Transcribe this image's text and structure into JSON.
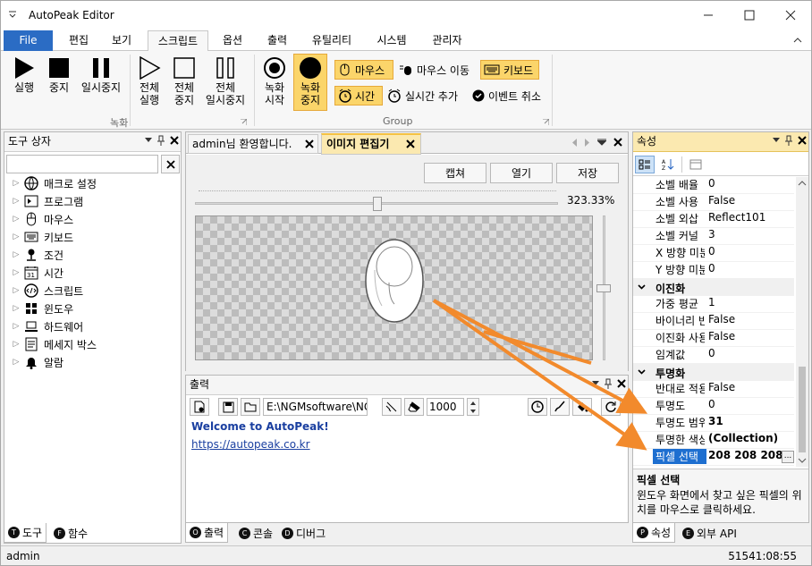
{
  "window": {
    "title": "AutoPeak Editor"
  },
  "ribbon_tabs": [
    "File",
    "편집",
    "보기",
    "스크립트",
    "옵션",
    "출력",
    "유틸리티",
    "시스템",
    "관리자"
  ],
  "ribbon": {
    "group1": [
      "실행",
      "중지",
      "일시중지"
    ],
    "group1b": [
      "전체\n실행",
      "전체\n중지",
      "전체\n일시중지"
    ],
    "group1_label": "녹화",
    "record": [
      "녹화\n시작",
      "녹화\n중지"
    ],
    "small": {
      "mouse": "마우스",
      "mouse_move": "마우스 이동",
      "keyboard": "키보드",
      "time": "시간",
      "realtime": "실시간 추가",
      "event_cancel": "이벤트 취소"
    },
    "group2_label": "Group"
  },
  "toolbox": {
    "title": "도구 상자",
    "items": [
      {
        "label": "매크로 설정",
        "icon": "globe-icon"
      },
      {
        "label": "프로그램",
        "icon": "program-icon"
      },
      {
        "label": "마우스",
        "icon": "mouse-icon"
      },
      {
        "label": "키보드",
        "icon": "keyboard-icon"
      },
      {
        "label": "조건",
        "icon": "condition-icon"
      },
      {
        "label": "시간",
        "icon": "calendar-icon",
        "num": "31"
      },
      {
        "label": "스크립트",
        "icon": "script-icon"
      },
      {
        "label": "윈도우",
        "icon": "windows-icon"
      },
      {
        "label": "하드웨어",
        "icon": "laptop-icon"
      },
      {
        "label": "메세지 박스",
        "icon": "message-icon"
      },
      {
        "label": "알람",
        "icon": "bell-icon"
      }
    ],
    "bottom_tabs": [
      {
        "letter": "T",
        "label": "도구"
      },
      {
        "letter": "F",
        "label": "함수"
      }
    ]
  },
  "doc_tabs": [
    "admin님 환영합니다.",
    "이미지 편집기"
  ],
  "editor": {
    "capture": "캡쳐",
    "open": "열기",
    "save": "저장",
    "zoom": "323.33%",
    "slider_fraction": 0.49
  },
  "output": {
    "title": "출력",
    "path": "E:\\NGMsoftware\\NG",
    "count": "1000",
    "lines": [
      "Welcome to AutoPeak!",
      "https://autopeak.co.kr"
    ],
    "bottom_tabs": [
      {
        "letter": "O",
        "label": "출력"
      },
      {
        "letter": "C",
        "label": "콘솔"
      },
      {
        "letter": "D",
        "label": "디버그"
      }
    ]
  },
  "properties": {
    "title": "속성",
    "rows_top": [
      {
        "k": "소벨 배율",
        "v": "0"
      },
      {
        "k": "소벨 사용",
        "v": "False"
      },
      {
        "k": "소벨 외삽",
        "v": "Reflect101"
      },
      {
        "k": "소벨 커널",
        "v": "3"
      },
      {
        "k": "X 방향 미분",
        "v": "0"
      },
      {
        "k": "Y 방향 미분",
        "v": "0"
      }
    ],
    "cat1": "이진화",
    "rows_mid": [
      {
        "k": "가중 평균",
        "v": "1"
      },
      {
        "k": "바이너리 반전",
        "v": "False"
      },
      {
        "k": "이진화 사용",
        "v": "False"
      },
      {
        "k": "임계값",
        "v": "0"
      }
    ],
    "cat2": "투명화",
    "rows_bot": [
      {
        "k": "반대로 적용",
        "v": "False"
      },
      {
        "k": "투명도",
        "v": "0"
      },
      {
        "k": "투명도 범위",
        "v": "31"
      },
      {
        "k": "투명한 색상",
        "v": "(Collection)"
      },
      {
        "k": "픽셀 선택",
        "v": "208 208 208"
      }
    ],
    "desc_title": "픽셀 선택",
    "desc_text": "윈도우 화면에서 찾고 싶은 픽셀의 위치를 마우스로 클릭하세요.",
    "bottom_tabs": [
      {
        "letter": "P",
        "label": "속성"
      },
      {
        "letter": "E",
        "label": "외부 API"
      }
    ]
  },
  "status": {
    "left": "admin",
    "right": "51541:08:55"
  }
}
